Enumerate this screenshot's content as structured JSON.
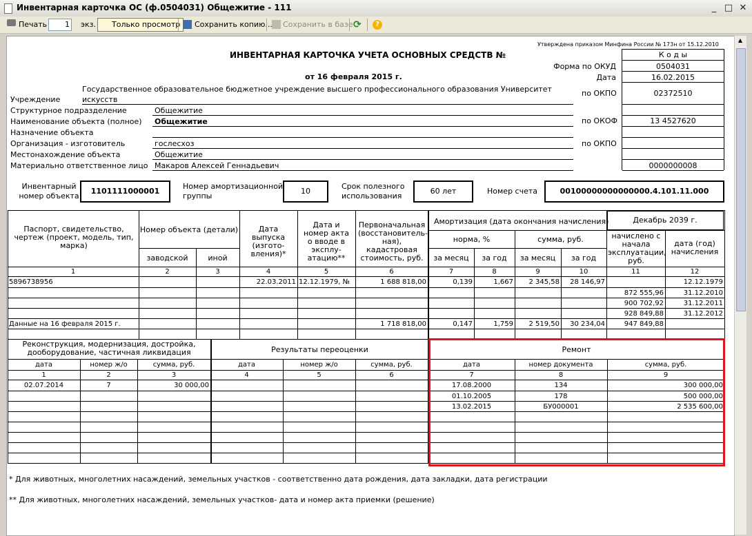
{
  "window": {
    "title": "Инвентарная карточка ОС (ф.0504031) Общежитие - 111",
    "controls": [
      "_",
      "□",
      "✕"
    ]
  },
  "toolbar": {
    "print": "Печать",
    "copies": "1",
    "copies_unit": "экз.",
    "view_only": "Только просмотр",
    "save_copy": "Сохранить копию...",
    "save_db": "Сохранить в базе",
    "refresh_icon": "refresh-icon",
    "help_icon": "help-icon"
  },
  "header": {
    "approved": "Утверждена приказом Минфина России   № 173н от 15.12.2010",
    "title": "ИНВЕНТАРНАЯ КАРТОЧКА УЧЕТА ОСНОВНЫХ СРЕДСТВ  №",
    "date_line": "от 16 февраля 2015 г.",
    "codes": {
      "caption": "К о д ы",
      "okud_label": "Форма по ОКУД",
      "okud": "0504031",
      "date_label": "Дата",
      "date": "16.02.2015",
      "okpo_label": "по ОКПО",
      "okpo": "02372510",
      "okof_label": "по ОКОФ",
      "okof": "13 4527620",
      "okpo2_label": "по ОКПО",
      "mol_code": "0000000008"
    },
    "fields": {
      "institution_label": "Учреждение",
      "institution_1": "Государственное образовательное бюджетное учреждение высшего профессионального образования  Университет",
      "institution_2": "искусств",
      "subdivision_label": "Структурное подразделение",
      "subdivision": "Общежитие",
      "object_name_label": "Наименование объекта (полное)",
      "object_name": "Общежитие",
      "purpose_label": "Назначение объекта",
      "manufacturer_label": "Организация - изготовитель",
      "manufacturer": "гослесхоз",
      "location_label": "Местонахождение объекта",
      "location": "Общежитие",
      "mol_label": "Материально ответственное лицо",
      "mol": "Макаров Алексей Геннадьевич"
    },
    "inv": {
      "inv_label_1": "Инвентарный",
      "inv_label_2": "номер объекта",
      "inv_number": "1101111000001",
      "group_label_1": "Номер амортизационной",
      "group_label_2": "группы",
      "group": "10",
      "life_label_1": "Срок полезного",
      "life_label_2": "использования",
      "life": "60 лет",
      "account_label": "Номер счета",
      "account": "00100000000000000.4.101.11.000"
    }
  },
  "table1": {
    "h_passport": "Паспорт, свидетельство, чертеж (проект, модель, тип, марка)",
    "h_objnum": "Номер объекта (детали)",
    "h_factory": "заводской",
    "h_other": "иной",
    "h_release": "Дата выпуска (изгото-вления)*",
    "h_act": "Дата и номер акта о вводе в эксплу-атацию**",
    "h_initial": "Первоначальная (восстановитель-ная), кадастровая стоимость, руб.",
    "h_amort": "Амортизация     (дата окончания начисления)",
    "h_amort_end": "Декабрь 2039 г.",
    "h_norm": "норма, %",
    "h_sum": "сумма, руб.",
    "h_month": "за месяц",
    "h_year": "за год",
    "h_month2": "за месяц",
    "h_year2": "за год",
    "h_accrued": "начислено с начала эксплуатации, руб.",
    "h_date_year": "дата (год) начисления",
    "col_nums": [
      "1",
      "2",
      "3",
      "4",
      "5",
      "6",
      "7",
      "8",
      "9",
      "10",
      "11",
      "12"
    ],
    "rows": [
      [
        "5896738956",
        "",
        "",
        "22.03.2011",
        "12.12.1979, №",
        "1 688 818,00",
        "0,139",
        "1,667",
        "2 345,58",
        "28 146,97",
        "",
        "12.12.1979"
      ],
      [
        "",
        "",
        "",
        "",
        "",
        "",
        "",
        "",
        "",
        "",
        "872 555,96",
        "31.12.2010"
      ],
      [
        "",
        "",
        "",
        "",
        "",
        "",
        "",
        "",
        "",
        "",
        "900 702,92",
        "31.12.2011"
      ],
      [
        "",
        "",
        "",
        "",
        "",
        "",
        "",
        "",
        "",
        "",
        "928 849,88",
        "31.12.2012"
      ],
      [
        "Данные на 16 февраля 2015 г.",
        "",
        "",
        "",
        "",
        "1 718 818,00",
        "0,147",
        "1,759",
        "2 519,50",
        "30 234,04",
        "947 849,88",
        ""
      ]
    ]
  },
  "table2": {
    "h_recon": "Реконструкция, модернизация, дострой­ка, дооборудование, частичная ликвидация",
    "h_reval": "Результаты переоценки",
    "h_repair": "Ремонт",
    "sub": [
      "дата",
      "номер ж/о",
      "сумма, руб.",
      "дата",
      "номер ж/о",
      "сумма, руб.",
      "дата",
      "номер документа",
      "сумма, руб."
    ],
    "col_nums": [
      "1",
      "2",
      "3",
      "4",
      "5",
      "6",
      "7",
      "8",
      "9"
    ],
    "recon_rows": [
      [
        "02.07.2014",
        "7",
        "30 000,00"
      ]
    ],
    "repair_rows": [
      [
        "17.08.2000",
        "134",
        "300 000,00"
      ],
      [
        "01.10.2005",
        "178",
        "500 000,00"
      ],
      [
        "13.02.2015",
        "БУ000001",
        "2 535 600,00"
      ]
    ]
  },
  "footnotes": {
    "f1": "* Для животных, многолетних насаждений, земельных участков - соответственно дата рождения, дата закладки, дата регистрации",
    "f2": "** Для животных, многолетних насаждений, земельных участков- дата и номер акта приемки (решение)"
  }
}
